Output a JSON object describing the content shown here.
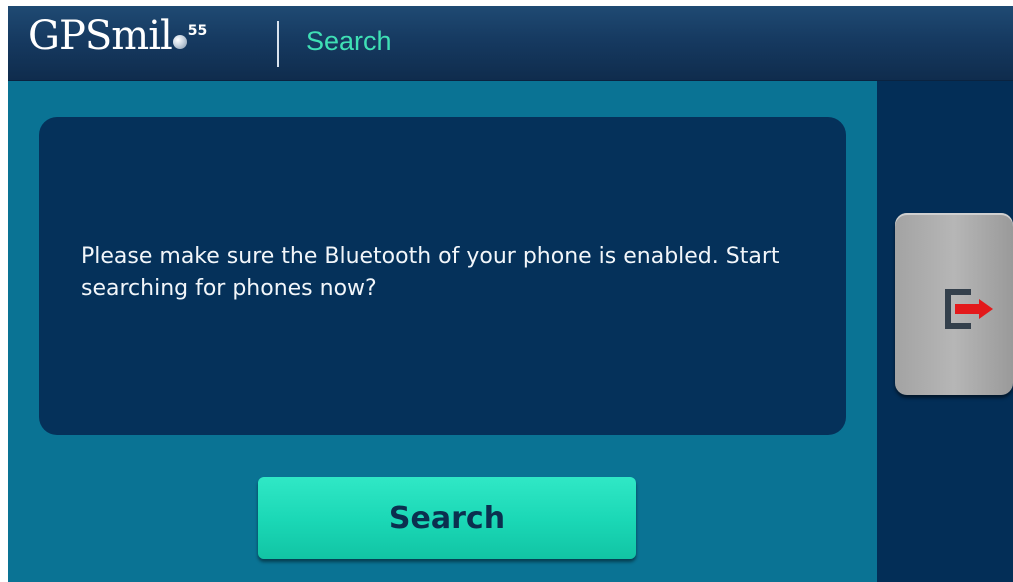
{
  "header": {
    "logo_text": "GPSmil",
    "logo_suffix": "55",
    "title": "Search"
  },
  "dialog": {
    "message": "Please make sure the Bluetooth of your phone is enabled. Start searching for phones now?"
  },
  "buttons": {
    "search_label": "Search",
    "exit_icon": "exit-arrow-icon"
  },
  "colors": {
    "background": "#0a7394",
    "header": "#163a61",
    "panel": "#05315a",
    "accent": "#3fe0b5",
    "search_button": "#1ad7b5",
    "exit_arrow": "#e3191b"
  }
}
